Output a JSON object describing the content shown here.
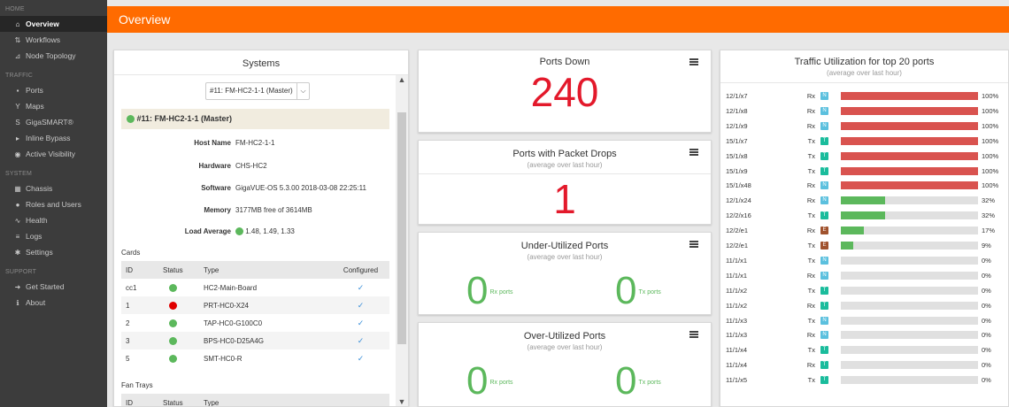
{
  "colors": {
    "header": "#ff6b00",
    "sidebar": "#3c3c3c",
    "ok_green": "#5cb85c",
    "alert_red": "#e3192b",
    "bar_red": "#d9534f",
    "bar_green": "#5cb85c",
    "badge_n": "#5bc0de",
    "badge_t": "#1abc9c",
    "badge_e": "#a0522d"
  },
  "sidebar": {
    "sections": [
      {
        "label": "HOME",
        "items": [
          {
            "label": "Overview",
            "icon": "home-icon",
            "glyph": "⌂"
          },
          {
            "label": "Workflows",
            "icon": "workflow-icon",
            "glyph": "⇅"
          },
          {
            "label": "Node Topology",
            "icon": "topology-icon",
            "glyph": "⊿"
          }
        ]
      },
      {
        "label": "TRAFFIC",
        "items": [
          {
            "label": "Ports",
            "icon": "ports-icon",
            "glyph": "▪"
          },
          {
            "label": "Maps",
            "icon": "maps-icon",
            "glyph": "Y"
          },
          {
            "label": "GigaSMART®",
            "icon": "gigasmart-icon",
            "glyph": "S"
          },
          {
            "label": "Inline Bypass",
            "icon": "bypass-icon",
            "glyph": "▸"
          },
          {
            "label": "Active Visibility",
            "icon": "eye-icon",
            "glyph": "◉"
          }
        ]
      },
      {
        "label": "SYSTEM",
        "items": [
          {
            "label": "Chassis",
            "icon": "chassis-icon",
            "glyph": "▦"
          },
          {
            "label": "Roles and Users",
            "icon": "user-icon",
            "glyph": "●"
          },
          {
            "label": "Health",
            "icon": "health-icon",
            "glyph": "∿"
          },
          {
            "label": "Logs",
            "icon": "logs-icon",
            "glyph": "≡"
          },
          {
            "label": "Settings",
            "icon": "gear-icon",
            "glyph": "✱"
          }
        ]
      },
      {
        "label": "SUPPORT",
        "items": [
          {
            "label": "Get Started",
            "icon": "start-icon",
            "glyph": "➜"
          },
          {
            "label": "About",
            "icon": "info-icon",
            "glyph": "ℹ"
          }
        ]
      }
    ]
  },
  "header": {
    "title": "Overview"
  },
  "systems": {
    "title": "Systems",
    "selected_system": "#11: FM-HC2-1-1 (Master)",
    "master_label": "#11: FM-HC2-1-1 (Master)",
    "info": [
      {
        "key": "Host Name",
        "value": "FM-HC2-1-1"
      },
      {
        "key": "Hardware",
        "value": "CHS-HC2"
      },
      {
        "key": "Software",
        "value": "GigaVUE-OS 5.3.00 2018-03-08 22:25:11"
      },
      {
        "key": "Memory",
        "value": "3177MB free of 3614MB"
      },
      {
        "key": "Load Average",
        "value": "1.48, 1.49, 1.33"
      }
    ],
    "cards_label": "Cards",
    "cards_columns": [
      "ID",
      "Status",
      "Type",
      "Configured"
    ],
    "cards": [
      {
        "id": "cc1",
        "status": "green",
        "type": "HC2-Main-Board",
        "configured": "✓"
      },
      {
        "id": "1",
        "status": "red",
        "type": "PRT-HC0-X24",
        "configured": "✓"
      },
      {
        "id": "2",
        "status": "green",
        "type": "TAP-HC0-G100C0",
        "configured": "✓"
      },
      {
        "id": "3",
        "status": "green",
        "type": "BPS-HC0-D25A4G",
        "configured": "✓"
      },
      {
        "id": "5",
        "status": "green",
        "type": "SMT-HC0-R",
        "configured": "✓"
      }
    ],
    "fan_label": "Fan Trays",
    "fan_columns": [
      "ID",
      "Status",
      "Type"
    ]
  },
  "ports_down": {
    "title": "Ports Down",
    "value": "240"
  },
  "packet_drops": {
    "title": "Ports with Packet Drops",
    "subtitle": "(average over last hour)",
    "value": "1"
  },
  "under_utilized": {
    "title": "Under-Utilized Ports",
    "subtitle": "(average over last hour)",
    "rx_value": "0",
    "rx_label": "Rx ports",
    "tx_value": "0",
    "tx_label": "Tx ports"
  },
  "over_utilized": {
    "title": "Over-Utilized Ports",
    "subtitle": "(average over last hour)",
    "rx_value": "0",
    "rx_label": "Rx ports",
    "tx_value": "0",
    "tx_label": "Tx ports"
  },
  "traffic": {
    "title": "Traffic Utilization for top 20 ports",
    "subtitle": "(average over last hour)",
    "rows": [
      {
        "port": "12/1/x7",
        "dir": "Rx",
        "badge": "N",
        "pct": 100,
        "label": "100%"
      },
      {
        "port": "12/1/x8",
        "dir": "Rx",
        "badge": "N",
        "pct": 100,
        "label": "100%"
      },
      {
        "port": "12/1/x9",
        "dir": "Rx",
        "badge": "N",
        "pct": 100,
        "label": "100%"
      },
      {
        "port": "15/1/x7",
        "dir": "Tx",
        "badge": "T",
        "pct": 100,
        "label": "100%"
      },
      {
        "port": "15/1/x8",
        "dir": "Tx",
        "badge": "T",
        "pct": 100,
        "label": "100%"
      },
      {
        "port": "15/1/x9",
        "dir": "Tx",
        "badge": "T",
        "pct": 100,
        "label": "100%"
      },
      {
        "port": "15/1/x48",
        "dir": "Rx",
        "badge": "N",
        "pct": 100,
        "label": "100%"
      },
      {
        "port": "12/1/x24",
        "dir": "Rx",
        "badge": "N",
        "pct": 32,
        "label": "32%"
      },
      {
        "port": "12/2/x16",
        "dir": "Tx",
        "badge": "T",
        "pct": 32,
        "label": "32%"
      },
      {
        "port": "12/2/e1",
        "dir": "Rx",
        "badge": "E",
        "pct": 17,
        "label": "17%"
      },
      {
        "port": "12/2/e1",
        "dir": "Tx",
        "badge": "E",
        "pct": 9,
        "label": "9%"
      },
      {
        "port": "11/1/x1",
        "dir": "Tx",
        "badge": "N",
        "pct": 0,
        "label": "0%"
      },
      {
        "port": "11/1/x1",
        "dir": "Rx",
        "badge": "N",
        "pct": 0,
        "label": "0%"
      },
      {
        "port": "11/1/x2",
        "dir": "Tx",
        "badge": "T",
        "pct": 0,
        "label": "0%"
      },
      {
        "port": "11/1/x2",
        "dir": "Rx",
        "badge": "T",
        "pct": 0,
        "label": "0%"
      },
      {
        "port": "11/1/x3",
        "dir": "Tx",
        "badge": "N",
        "pct": 0,
        "label": "0%"
      },
      {
        "port": "11/1/x3",
        "dir": "Rx",
        "badge": "N",
        "pct": 0,
        "label": "0%"
      },
      {
        "port": "11/1/x4",
        "dir": "Tx",
        "badge": "T",
        "pct": 0,
        "label": "0%"
      },
      {
        "port": "11/1/x4",
        "dir": "Rx",
        "badge": "T",
        "pct": 0,
        "label": "0%"
      },
      {
        "port": "11/1/x5",
        "dir": "Tx",
        "badge": "T",
        "pct": 0,
        "label": "0%"
      }
    ]
  }
}
